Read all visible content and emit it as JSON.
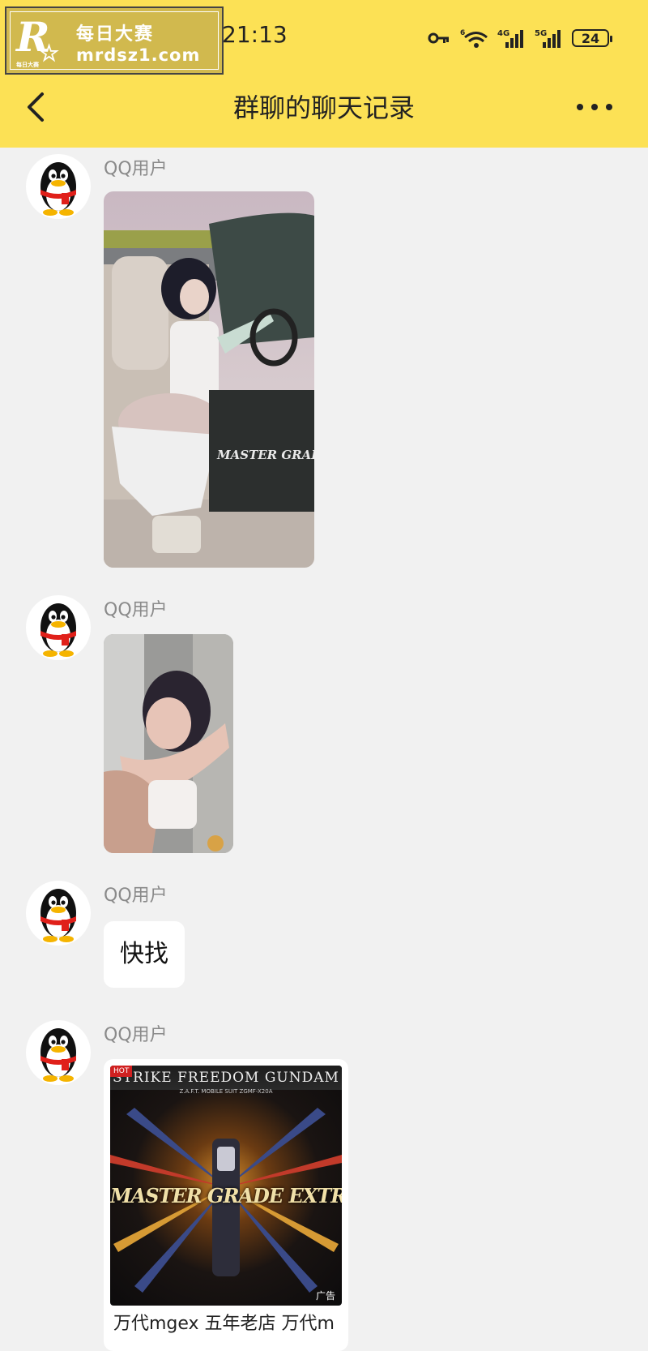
{
  "watermark": {
    "title": "每日大赛",
    "url": "mrdsz1.com",
    "logo_letter": "R",
    "logo_sub": "每日大赛"
  },
  "status_bar": {
    "time": "21:13",
    "network_6": "6",
    "network_4g": "4G",
    "network_5g": "5G",
    "battery": "24"
  },
  "nav": {
    "title": "群聊的聊天记录"
  },
  "messages": [
    {
      "sender": "QQ用户",
      "type": "image"
    },
    {
      "sender": "QQ用户",
      "type": "image"
    },
    {
      "sender": "QQ用户",
      "type": "text",
      "text": "快找"
    },
    {
      "sender": "QQ用户",
      "type": "ad_card",
      "card": {
        "banner": "STRIKE FREEDOM GUNDAM",
        "banner_sub": "Z.A.F.T. MOBILE SUIT ZGMF-X20A",
        "hot": "HOT",
        "headline": "MASTER GRADE EXTREME",
        "ad_label": "广告",
        "caption": "万代mgex 五年老店 万代m"
      }
    }
  ],
  "icons": {
    "avatar": "qq-penguin-icon",
    "back": "chevron-left-icon",
    "more": "more-icon",
    "key": "vpn-key-icon",
    "wifi": "wifi-icon",
    "signal": "signal-icon"
  }
}
